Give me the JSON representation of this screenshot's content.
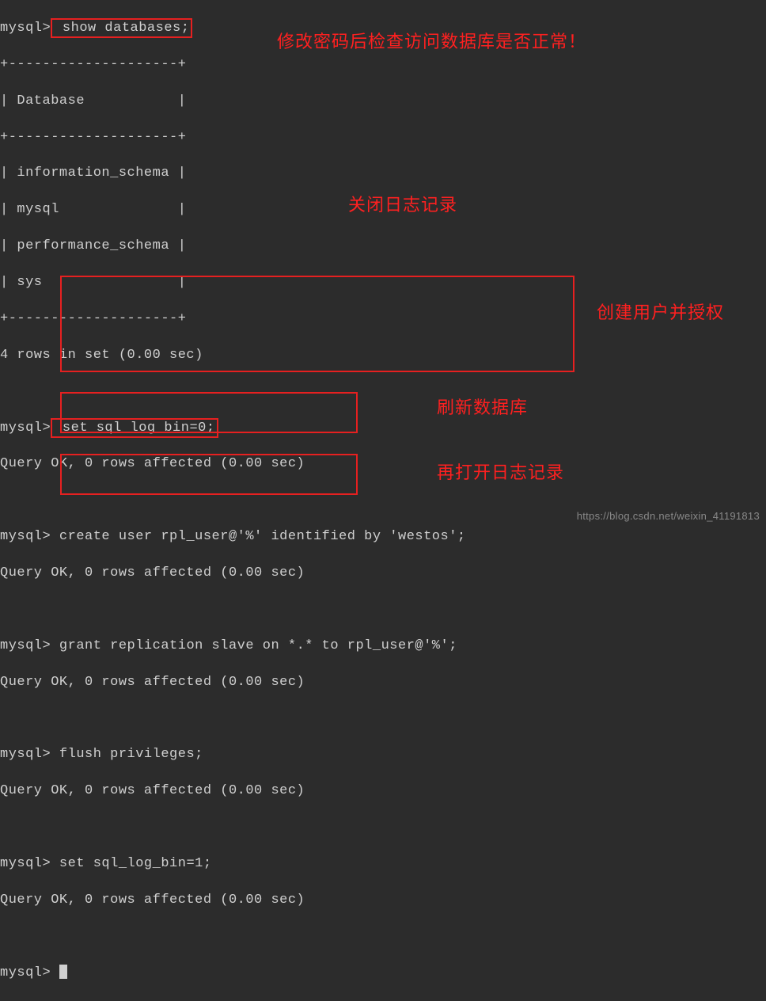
{
  "prompt": "mysql>",
  "commands": {
    "show_db": " show databases;",
    "log_off": " set sql_log_bin=0;",
    "create_user": " create user rpl_user@'%' identified by 'westos';",
    "grant": " grant replication slave on *.* to rpl_user@'%';",
    "flush": " flush privileges;",
    "log_on": " set sql_log_bin=1;"
  },
  "table": {
    "sep": "+--------------------+",
    "header": "| Database           |",
    "rows": [
      "| information_schema |",
      "| mysql              |",
      "| performance_schema |",
      "| sys                |"
    ],
    "summary": "4 rows in set (0.00 sec)"
  },
  "result_ok": "Query OK, 0 rows affected (0.00 sec)",
  "annotations": {
    "check_db": "修改密码后检查访问数据库是否正常！",
    "log_off": "关闭日志记录",
    "create_user": "创建用户并授权",
    "flush": "刷新数据库",
    "log_on": "再打开日志记录"
  },
  "watermark": "https://blog.csdn.net/weixin_41191813"
}
